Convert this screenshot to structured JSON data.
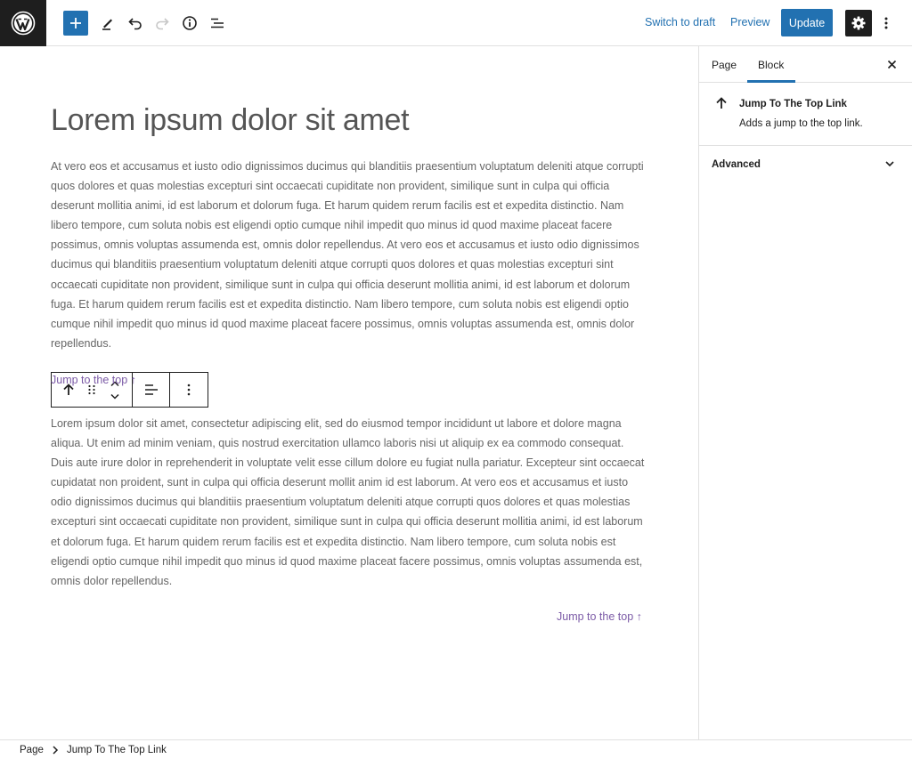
{
  "topbar": {
    "switch_to_draft": "Switch to draft",
    "preview": "Preview",
    "update": "Update"
  },
  "editor": {
    "title": "Lorem ipsum dolor sit amet",
    "paragraph1": "At vero eos et accusamus et iusto odio dignissimos ducimus qui blanditiis praesentium voluptatum deleniti atque corrupti quos dolores et quas molestias excepturi sint occaecati cupiditate non provident, similique sunt in culpa qui officia deserunt mollitia animi, id est laborum et dolorum fuga. Et harum quidem rerum facilis est et expedita distinctio. Nam libero tempore, cum soluta nobis est eligendi optio cumque nihil impedit quo minus id quod maxime placeat facere possimus, omnis voluptas assumenda est, omnis dolor repellendus. At vero eos et accusamus et iusto odio dignissimos ducimus qui blanditiis praesentium voluptatum deleniti atque corrupti quos dolores et quas molestias excepturi sint occaecati cupiditate non provident, similique sunt in culpa qui officia deserunt mollitia animi, id est laborum et dolorum fuga. Et harum quidem rerum facilis est et expedita distinctio. Nam libero tempore, cum soluta nobis est eligendi optio cumque nihil impedit quo minus id quod maxime placeat facere possimus, omnis voluptas assumenda est, omnis dolor repellendus.",
    "jump_link1": "Jump to the top ↑",
    "paragraph2": "Lorem ipsum dolor sit amet, consectetur adipiscing elit, sed do eiusmod tempor incididunt ut labore et dolore magna aliqua. Ut enim ad minim veniam, quis nostrud exercitation ullamco laboris nisi ut aliquip ex ea commodo consequat. Duis aute irure dolor in reprehenderit in voluptate velit esse cillum dolore eu fugiat nulla pariatur. Excepteur sint occaecat cupidatat non proident, sunt in culpa qui officia deserunt mollit anim id est laborum. At vero eos et accusamus et iusto odio dignissimos ducimus qui blanditiis praesentium voluptatum deleniti atque corrupti quos dolores et quas molestias excepturi sint occaecati cupiditate non provident, similique sunt in culpa qui officia deserunt mollitia animi, id est laborum et dolorum fuga. Et harum quidem rerum facilis est et expedita distinctio. Nam libero tempore, cum soluta nobis est eligendi optio cumque nihil impedit quo minus id quod maxime placeat facere possimus, omnis voluptas assumenda est, omnis dolor repellendus.",
    "jump_link2": "Jump to the top ↑"
  },
  "sidebar": {
    "tabs": [
      {
        "label": "Page",
        "active": false
      },
      {
        "label": "Block",
        "active": true
      }
    ],
    "block": {
      "title": "Jump To The Top Link",
      "description": "Adds a jump to the top link."
    },
    "advanced_label": "Advanced"
  },
  "footer": {
    "breadcrumb": [
      "Page",
      "Jump To The Top Link"
    ]
  },
  "colors": {
    "accent": "#2271b1",
    "link": "#7b5aa6",
    "dark": "#1e1e1e"
  },
  "icons": {
    "topbar": [
      "wordpress-logo-icon",
      "plus-icon",
      "pencil-icon",
      "undo-icon",
      "redo-icon",
      "info-icon",
      "list-view-icon",
      "gear-icon",
      "more-vertical-icon"
    ],
    "block_toolbar": [
      "arrow-up-icon",
      "drag-handle-icon",
      "chevron-up-icon",
      "chevron-down-icon",
      "align-left-icon",
      "more-vertical-icon"
    ]
  }
}
